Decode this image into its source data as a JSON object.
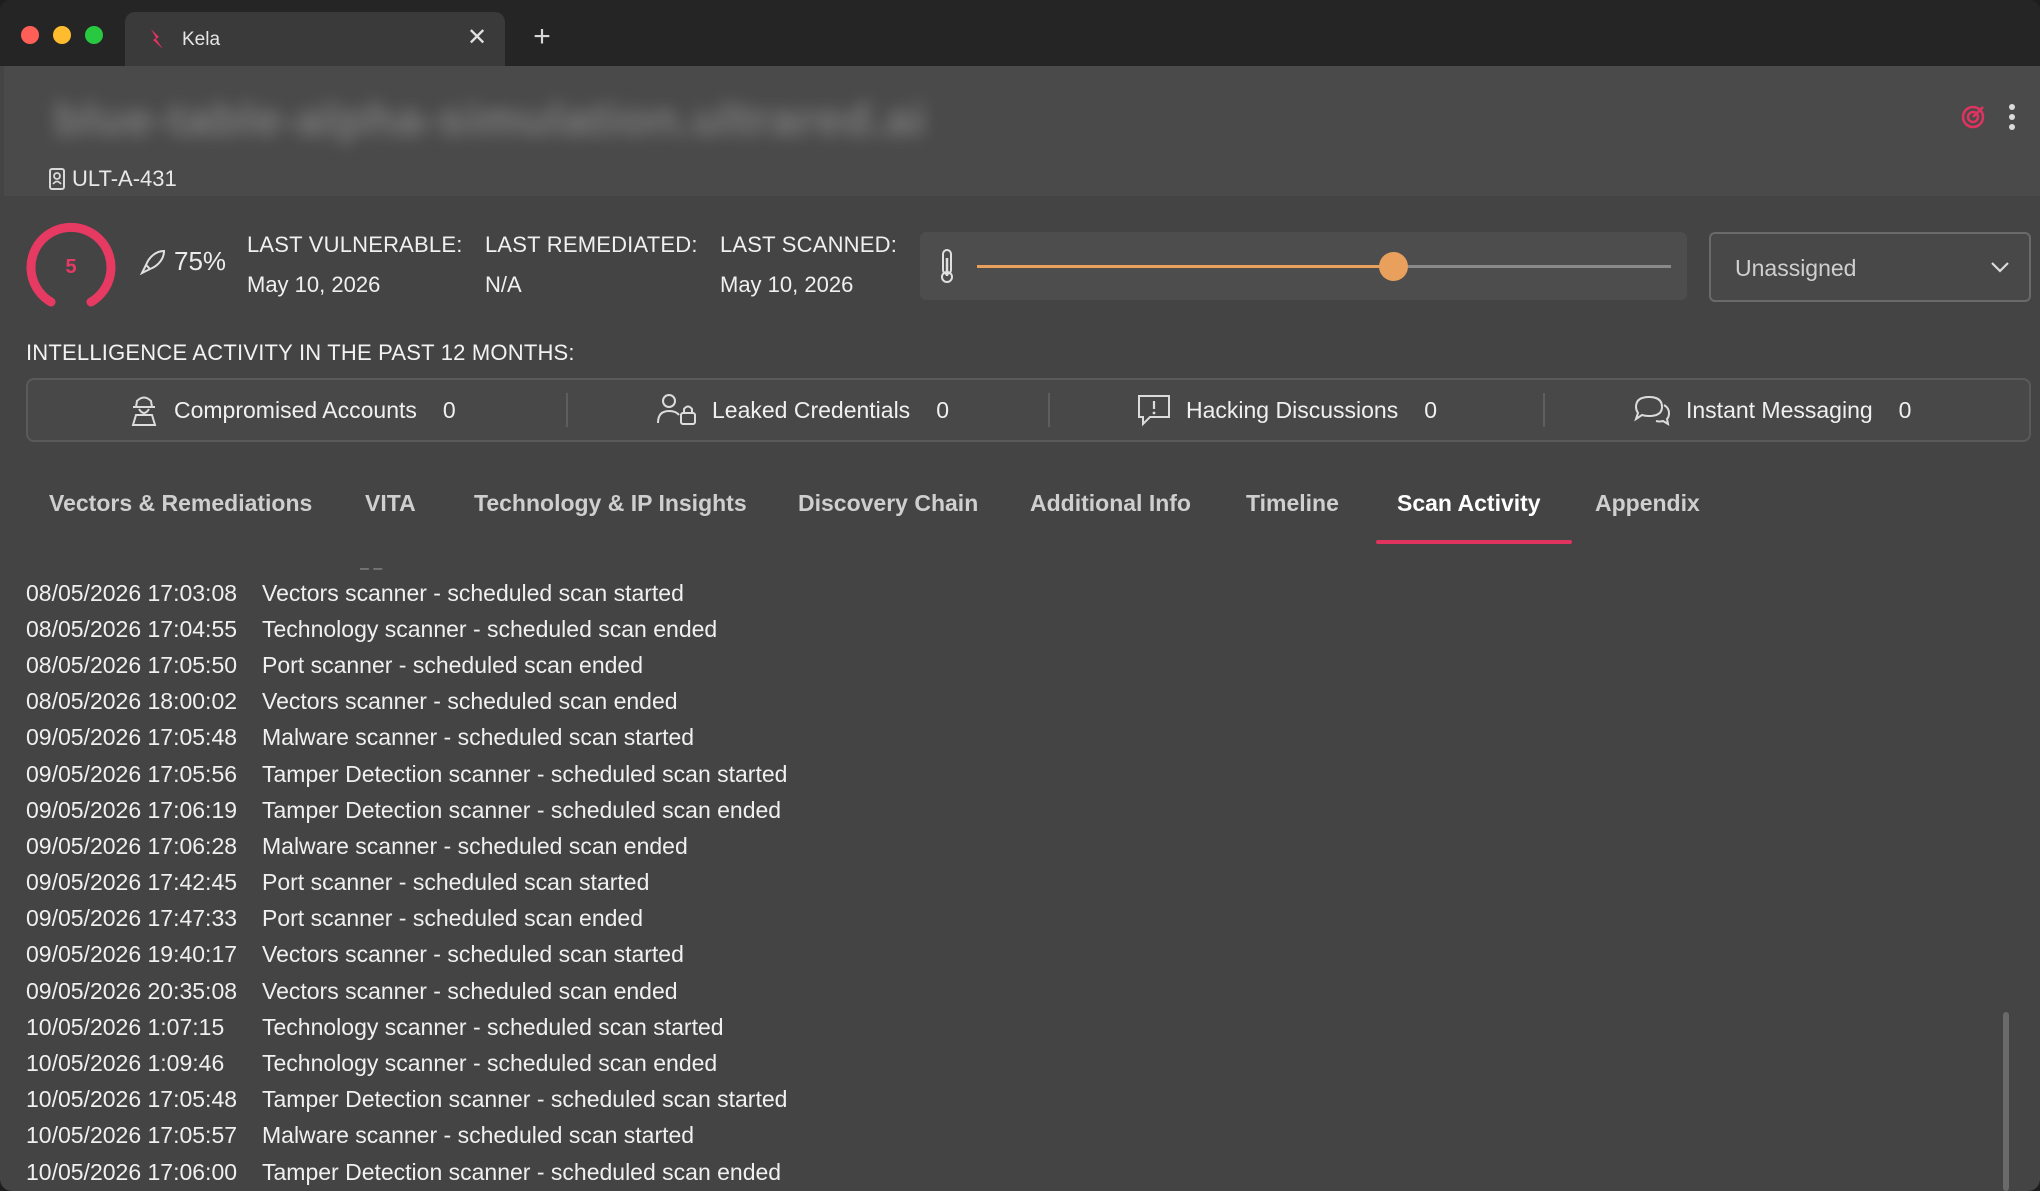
{
  "browser": {
    "tab_title": "Kela",
    "close_glyph": "✕",
    "new_tab_glyph": "+"
  },
  "header": {
    "blurred_title": "blue-table-alpha-simulation.ultrared.ai",
    "asset_id": "ULT-A-431"
  },
  "score": {
    "value": "5",
    "confidence": "75%",
    "accent_color": "#e63a63"
  },
  "stats": {
    "last_vulnerable_label": "LAST VULNERABLE:",
    "last_vulnerable_value": "May 10, 2026",
    "last_remediated_label": "LAST REMEDIATED:",
    "last_remediated_value": "N/A",
    "last_scanned_label": "LAST SCANNED:",
    "last_scanned_value": "May 10, 2026"
  },
  "slider": {
    "level_fraction": 0.6,
    "color": "#e8a05c"
  },
  "assignee": {
    "selected": "Unassigned"
  },
  "intelligence": {
    "heading": "INTELLIGENCE ACTIVITY IN THE PAST 12 MONTHS:",
    "items": [
      {
        "label": "Compromised Accounts",
        "count": "0",
        "icon": "hacker-icon"
      },
      {
        "label": "Leaked Credentials",
        "count": "0",
        "icon": "users-lock-icon"
      },
      {
        "label": "Hacking Discussions",
        "count": "0",
        "icon": "alert-message-icon"
      },
      {
        "label": "Instant Messaging",
        "count": "0",
        "icon": "chat-bubbles-icon"
      }
    ]
  },
  "tabs": [
    {
      "label": "Vectors & Remediations"
    },
    {
      "label": "VITA"
    },
    {
      "label": "Technology & IP Insights"
    },
    {
      "label": "Discovery Chain"
    },
    {
      "label": "Additional Info"
    },
    {
      "label": "Timeline"
    },
    {
      "label": "Scan Activity",
      "active": true
    },
    {
      "label": "Appendix"
    }
  ],
  "tab_accent": "#e0335f",
  "scan_log": [
    {
      "ts": "08/05/2026 17:03:08",
      "msg": "Vectors scanner - scheduled scan started"
    },
    {
      "ts": "08/05/2026 17:04:55",
      "msg": "Technology scanner - scheduled scan ended"
    },
    {
      "ts": "08/05/2026 17:05:50",
      "msg": "Port scanner - scheduled scan ended"
    },
    {
      "ts": "08/05/2026 18:00:02",
      "msg": "Vectors scanner - scheduled scan ended"
    },
    {
      "ts": "09/05/2026 17:05:48",
      "msg": "Malware scanner - scheduled scan started"
    },
    {
      "ts": "09/05/2026 17:05:56",
      "msg": "Tamper Detection scanner - scheduled scan started"
    },
    {
      "ts": "09/05/2026 17:06:19",
      "msg": "Tamper Detection scanner - scheduled scan ended"
    },
    {
      "ts": "09/05/2026 17:06:28",
      "msg": "Malware scanner - scheduled scan ended"
    },
    {
      "ts": "09/05/2026 17:42:45",
      "msg": "Port scanner - scheduled scan started"
    },
    {
      "ts": "09/05/2026 17:47:33",
      "msg": "Port scanner - scheduled scan ended"
    },
    {
      "ts": "09/05/2026 19:40:17",
      "msg": "Vectors scanner - scheduled scan started"
    },
    {
      "ts": "09/05/2026 20:35:08",
      "msg": "Vectors scanner - scheduled scan ended"
    },
    {
      "ts": "10/05/2026 1:07:15",
      "msg": "Technology scanner - scheduled scan started"
    },
    {
      "ts": "10/05/2026 1:09:46",
      "msg": "Technology scanner - scheduled scan ended"
    },
    {
      "ts": "10/05/2026 17:05:48",
      "msg": "Tamper Detection scanner - scheduled scan started"
    },
    {
      "ts": "10/05/2026 17:05:57",
      "msg": "Malware scanner - scheduled scan started"
    },
    {
      "ts": "10/05/2026 17:06:00",
      "msg": "Tamper Detection scanner - scheduled scan ended"
    }
  ]
}
